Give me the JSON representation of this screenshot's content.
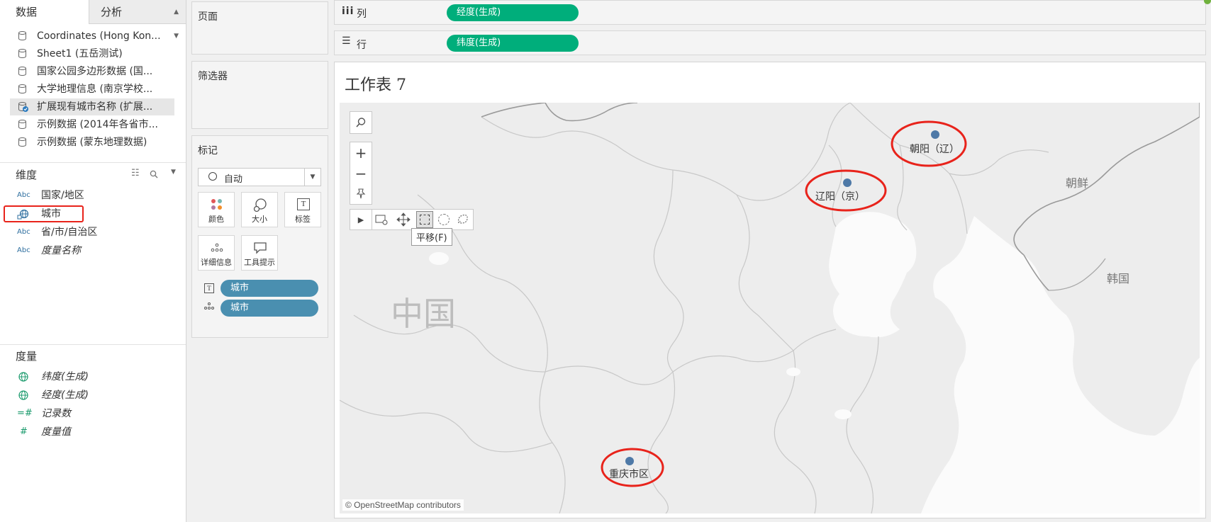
{
  "tabs": {
    "data": "数据",
    "analysis": "分析"
  },
  "datasources": [
    {
      "label": "Coordinates (Hong Kon..."
    },
    {
      "label": "Sheet1 (五岳测试)"
    },
    {
      "label": "国家公园多边形数据 (国..."
    },
    {
      "label": "大学地理信息 (南京学校..."
    },
    {
      "label": "扩展现有城市名称 (扩展...",
      "selected": true
    },
    {
      "label": "示例数据 (2014年各省市..."
    },
    {
      "label": "示例数据 (蒙东地理数据)"
    }
  ],
  "dimensions": {
    "title": "维度",
    "items": [
      {
        "icon": "Abc",
        "label": "国家/地区"
      },
      {
        "icon": "geo",
        "label": "城市",
        "highlighted": true
      },
      {
        "icon": "Abc",
        "label": "省/市/自治区"
      },
      {
        "icon": "Abc",
        "label": "度量名称"
      }
    ]
  },
  "measures": {
    "title": "度量",
    "items": [
      {
        "icon": "globe",
        "label": "纬度(生成)"
      },
      {
        "icon": "globe",
        "label": "经度(生成)"
      },
      {
        "icon": "=#",
        "label": "记录数"
      },
      {
        "icon": "#",
        "label": "度量值"
      }
    ]
  },
  "cards": {
    "pages": "页面",
    "filters": "筛选器",
    "marks": {
      "title": "标记",
      "type": "自动",
      "buttons": [
        "颜色",
        "大小",
        "标签",
        "详细信息",
        "工具提示"
      ],
      "pills": [
        "城市",
        "城市"
      ]
    }
  },
  "shelves": {
    "columns": {
      "label": "列",
      "pill": "经度(生成)"
    },
    "rows": {
      "label": "行",
      "pill": "纬度(生成)"
    }
  },
  "view": {
    "title": "工作表 7",
    "tooltip": "平移(F)",
    "copyright": "© OpenStreetMap contributors",
    "country_labels": [
      "中国",
      "朝鲜",
      "韩国"
    ],
    "cities": [
      "朝阳（辽）",
      "辽阳（京）",
      "重庆市区"
    ]
  },
  "colors": {
    "pill_green": "#00ae7b",
    "pill_blue": "#4a8fb0",
    "mark": "#4e79a7",
    "highlight": "#e8231b"
  }
}
